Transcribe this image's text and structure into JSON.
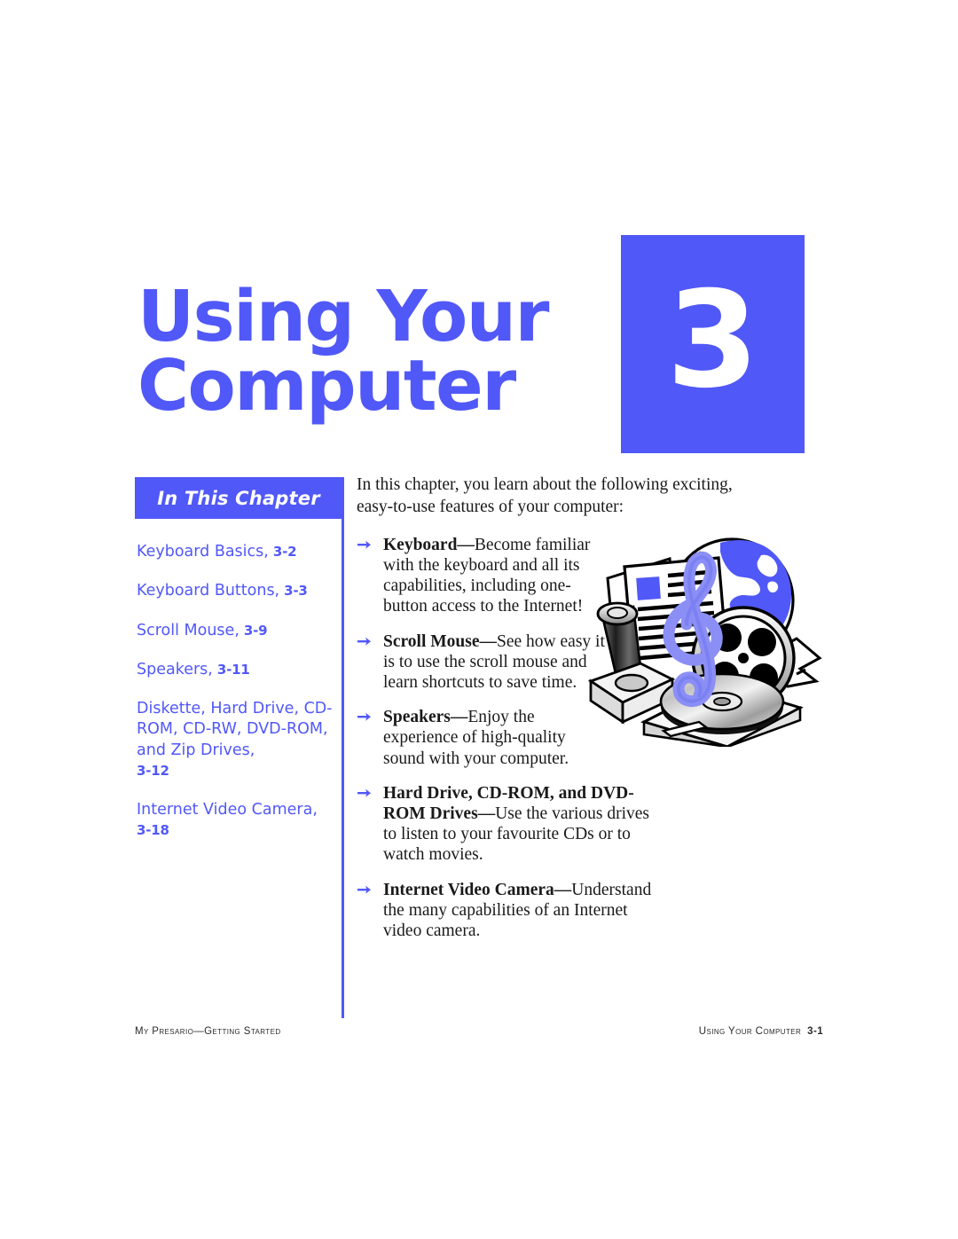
{
  "colors": {
    "accent": "#5158F8",
    "text": "#1A1A1A",
    "white": "#FFFFFF"
  },
  "header": {
    "chapter_title": "Using Your\nComputer",
    "chapter_number": "3"
  },
  "sidebar": {
    "heading": "In This Chapter",
    "items": [
      {
        "label": "Keyboard Basics,",
        "page": "3-2"
      },
      {
        "label": "Keyboard Buttons,",
        "page": "3-3"
      },
      {
        "label": "Scroll Mouse,",
        "page": "3-9"
      },
      {
        "label": "Speakers,",
        "page": "3-11"
      },
      {
        "label": "Diskette, Hard Drive, CD-ROM, CD-RW, DVD-ROM, and Zip Drives,",
        "page": "3-12"
      },
      {
        "label": "Internet Video Camera,",
        "page": "3-18"
      }
    ]
  },
  "main": {
    "intro": "In this chapter, you learn about the following exciting, easy-to-use features of your computer:",
    "bullets": [
      {
        "term": "Keyboard",
        "dash": "—",
        "text": "Become familiar with the keyboard and all its capabilities, including one-button access to the Internet!"
      },
      {
        "term": "Scroll Mouse",
        "dash": "—",
        "text": "See how easy it is to use the scroll mouse and learn shortcuts to save time."
      },
      {
        "term": "Speakers",
        "dash": "—",
        "text": "Enjoy the experience of high-quality sound with your computer."
      },
      {
        "term": "Hard Drive, CD-ROM, and DVD-ROM Drives",
        "dash": "—",
        "text": "Use the various drives to listen to your favourite CDs or to watch movies."
      },
      {
        "term": "Internet Video Camera",
        "dash": "—",
        "text": "Understand the many capabilities of an Internet video camera."
      }
    ]
  },
  "artwork": {
    "name": "multimedia-collage-illustration",
    "elements": [
      "globe-icon",
      "document-icon",
      "joystick-icon",
      "treble-clef-icon",
      "film-reel-icon",
      "cd-disc-icon",
      "filmstrip-icon"
    ]
  },
  "footer": {
    "left": "My Presario—Getting Started",
    "right": "Using Your Computer",
    "page_number": "3-1"
  }
}
